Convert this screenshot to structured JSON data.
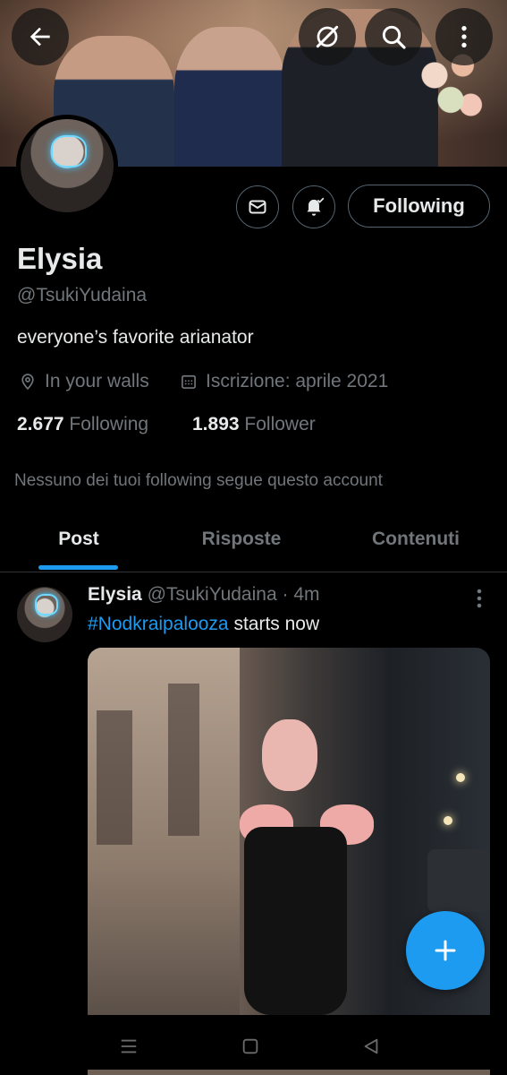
{
  "header": {
    "back_icon": "arrow-left-icon",
    "grok_icon": "grok-icon",
    "search_icon": "search-icon",
    "more_icon": "more-vertical-icon"
  },
  "profile": {
    "name": "Elysia",
    "handle": "@TsukiYudaina",
    "bio": "everyone’s favorite arianator",
    "location": "In your walls",
    "joined": "Iscrizione: aprile 2021",
    "following_count": "2.677",
    "following_label": "Following",
    "followers_count": "1.893",
    "followers_label": "Follower",
    "mutuals_note": "Nessuno dei tuoi following segue questo account",
    "follow_button_label": "Following"
  },
  "tabs": [
    {
      "label": "Post",
      "active": true
    },
    {
      "label": "Risposte",
      "active": false
    },
    {
      "label": "Contenuti",
      "active": false
    }
  ],
  "post": {
    "author": "Elysia",
    "handle": "@TsukiYudaina",
    "separator": "·",
    "time": "4m",
    "hashtag": "#Nodkraipalooza",
    "text": " starts now"
  },
  "colors": {
    "accent": "#1d9bf0",
    "background": "#000000",
    "text_primary": "#e7e9ea",
    "text_secondary": "#71767b"
  }
}
